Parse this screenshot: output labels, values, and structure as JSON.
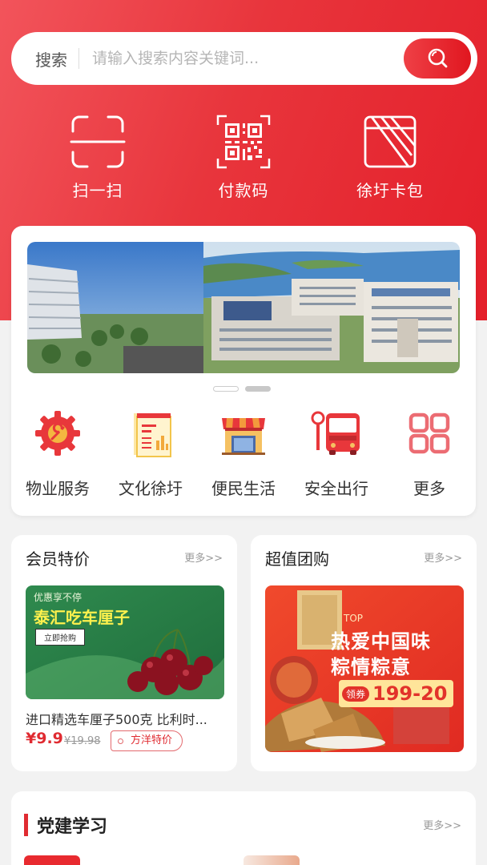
{
  "search": {
    "label": "搜索",
    "placeholder": "请输入搜索内容关键词..."
  },
  "quick_actions": [
    {
      "label": "扫一扫",
      "icon": "scan-icon"
    },
    {
      "label": "付款码",
      "icon": "qr-code-icon"
    },
    {
      "label": "徐圩卡包",
      "icon": "card-wallet-icon"
    }
  ],
  "services": [
    {
      "label": "物业服务",
      "icon": "gear-wrench-icon"
    },
    {
      "label": "文化徐圩",
      "icon": "document-chart-icon"
    },
    {
      "label": "便民生活",
      "icon": "storefront-icon"
    },
    {
      "label": "安全出行",
      "icon": "bus-icon"
    },
    {
      "label": "更多",
      "icon": "grid-more-icon"
    }
  ],
  "member": {
    "title": "会员特价",
    "more": "更多>>",
    "banner_top": "优惠享不停",
    "banner_main": "泰汇吃车厘子",
    "banner_btn": "立即抢购",
    "product": "进口精选车厘子500克 比利时...",
    "price": "¥9.9",
    "old_price": "¥19.98",
    "tag": "方洋特价"
  },
  "group": {
    "title": "超值团购",
    "more": "更多>>",
    "banner_top": "TOP",
    "banner_line1": "热爱中国味",
    "banner_line2": "粽情粽意",
    "coupon_prefix": "领券",
    "coupon_value": "199-20"
  },
  "party": {
    "title": "党建学习",
    "more": "更多>>"
  },
  "colors": {
    "brand_red": "#e41f2a",
    "price_red": "#e02b31"
  }
}
